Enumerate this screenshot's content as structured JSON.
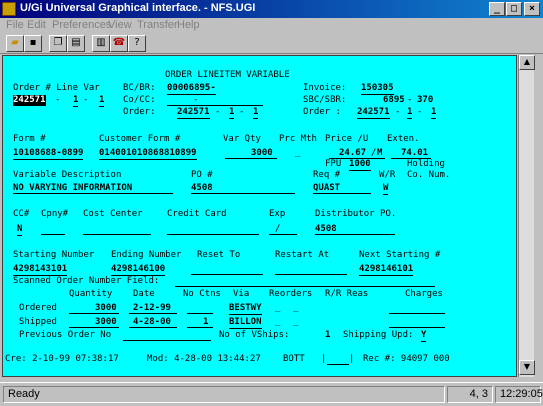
{
  "window": {
    "title": "U/Gi Universal Graphical interface. - NFS.UGI",
    "controls": [
      "_",
      "□",
      "×"
    ]
  },
  "menu": [
    "File",
    "Edit",
    "Preferences",
    "View",
    "Transfer",
    "Help"
  ],
  "toolbar": {
    "icons": [
      "open-folder-icon",
      "save-icon",
      "copy-icon",
      "paste-icon",
      "print-icon",
      "phone-icon",
      "help-icon"
    ]
  },
  "screen": {
    "heading": "ORDER LINEITEM VARIABLE",
    "labels": {
      "order_line_var": "Order # Line Var",
      "bc_br": "BC/BR:",
      "co_cc": "Co/CC:",
      "order": "Order:",
      "invoice": "Invoice:",
      "sbc_sbr": "SBC/SBR:",
      "order2": "Order  :",
      "form": "Form #",
      "customer_form": "Customer Form #",
      "var_qty": "Var Qty",
      "prc_mth": "Prc Mth",
      "price_u": "Price /U",
      "exten": "Exten.",
      "fpu": "FPU",
      "holding": "Holding",
      "variable_description": "Variable Description",
      "po": "PO #",
      "req": "Req #",
      "w_r": "W/R",
      "co_num": "Co. Num.",
      "cc": "CC#",
      "cpny": "Cpny#",
      "cost_center": "Cost Center",
      "credit_card": "Credit Card",
      "exp": "Exp",
      "distributor_po": "Distributor PO.",
      "starting_number": "Starting Number",
      "ending_number": "Ending Number",
      "reset_to": "Reset To",
      "restart_at": "Restart At",
      "next_starting": "Next Starting #",
      "scanned_order": "Scanned Order Number Field:",
      "quantity": "Quantity",
      "date": "Date",
      "no_ctns": "No Ctns",
      "via": "Via",
      "reorders": "Reorders",
      "rr_reas": "R/R Reas",
      "charges": "Charges",
      "ordered": "Ordered",
      "shipped": "Shipped",
      "previous_order": "Previous Order No",
      "no_vships": "No of VShips:",
      "shipping_upd": "Shipping Upd:"
    },
    "values": {
      "order_num": "242571",
      "line": "1",
      "var": "1",
      "bc_br": "00006895-",
      "co_cc_sep": "-",
      "order_a": "242571",
      "order_b": "1",
      "order_c": "1",
      "invoice": "150305",
      "sbc": "6895",
      "sbr": "370",
      "order2_a": "242571",
      "order2_b": "1",
      "order2_c": "1",
      "form": "10108688-0899",
      "customer_form": "014001010868810899",
      "var_qty": "3000",
      "prc_mth": "_",
      "price": "24.67",
      "per": "M",
      "exten": "74.01",
      "fpu": "1000",
      "variable_description": "NO VARYING INFORMATION",
      "po": "4508",
      "req": "QUAST",
      "w_r": "W",
      "cc": "N",
      "exp_sep": "/",
      "distributor_po": "4508",
      "starting_number": "4298143101",
      "ending_number": "4298146100",
      "next_starting": "4298146101",
      "ordered_qty": "3000",
      "ordered_date": "2-12-99",
      "ordered_via": "BESTWY",
      "shipped_qty": "3000",
      "shipped_date": "4-28-00",
      "shipped_ctns": "1",
      "shipped_via": "BILLON",
      "no_vships": "1",
      "shipping_upd": "Y"
    },
    "footer": {
      "cre": "Cre:  2-10-99 07:38:17",
      "mod": "Mod:  4-28-00 13:44:27",
      "user": "BOTT",
      "rec": "Rec #: 94097 000"
    }
  },
  "status": {
    "text": "Ready",
    "cursor": "4, 3",
    "clock": "12:29:05"
  }
}
